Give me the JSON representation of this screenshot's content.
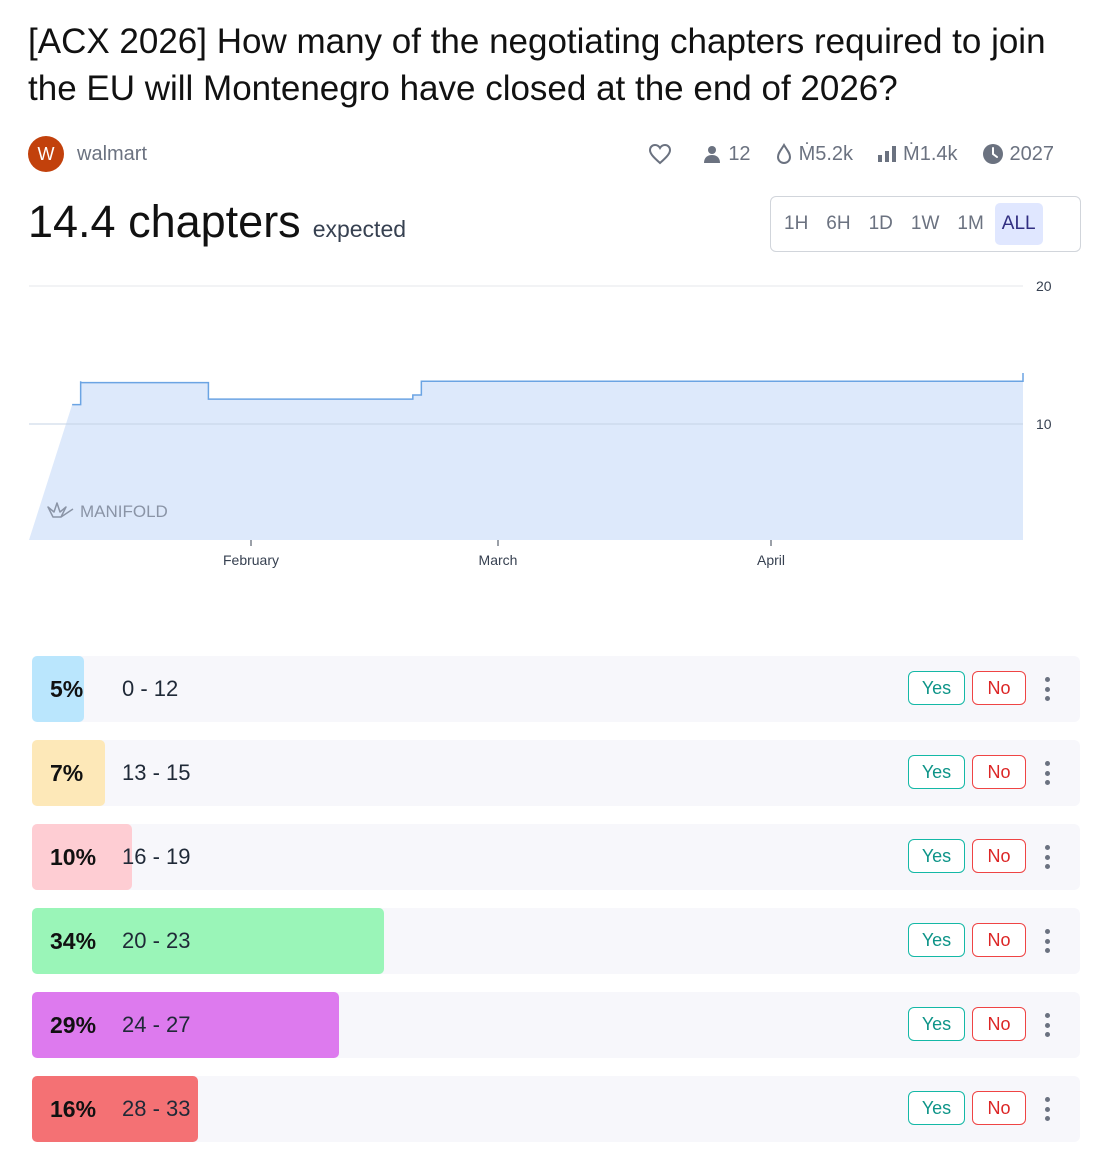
{
  "market": {
    "title": "[ACX 2026] How many of the negotiating chapters required to join the EU will Montenegro have closed at the end of 2026?",
    "author_initial": "W",
    "author": "walmart",
    "traders": "12",
    "volume": "Ṁ5.2k",
    "liquidity": "Ṁ1.4k",
    "close_year": "2027",
    "expected_value": "14.4 chapters",
    "expected_label": "expected"
  },
  "time_ranges": [
    "1H",
    "6H",
    "1D",
    "1W",
    "1M",
    "ALL"
  ],
  "selected_range": "ALL",
  "watermark": "MANIFOLD",
  "chart_data": {
    "type": "area",
    "x": [
      "Jan 11",
      "Jan 12",
      "Jan 12",
      "Jan 26",
      "Jan 27",
      "Feb 20",
      "Feb 21",
      "Apr 27",
      "May 3",
      "May 4",
      "May 10"
    ],
    "y": [
      11.4,
      13.1,
      13.0,
      13.0,
      11.8,
      12.1,
      13.1,
      13.1,
      13.2,
      13.5,
      13.7
    ],
    "x_ticks": [
      "February",
      "March",
      "April"
    ],
    "y_ticks": [
      10,
      20
    ],
    "ylim": [
      0,
      21
    ],
    "grid": "horizontal",
    "color": "#6ba4e3",
    "fill": "#dde9fb"
  },
  "answers": [
    {
      "pct": "5%",
      "value": 0.05,
      "label": "0 - 12",
      "color": "#bae6fd"
    },
    {
      "pct": "7%",
      "value": 0.07,
      "label": "13 - 15",
      "color": "#fde8b8"
    },
    {
      "pct": "10%",
      "value": 0.095,
      "label": "16 - 19",
      "color": "#fecdd3"
    },
    {
      "pct": "34%",
      "value": 0.336,
      "label": "20 - 23",
      "color": "#9af5b8"
    },
    {
      "pct": "29%",
      "value": 0.293,
      "label": "24 - 27",
      "color": "#dd7aee"
    },
    {
      "pct": "16%",
      "value": 0.158,
      "label": "28 - 33",
      "color": "#f47174"
    }
  ],
  "buttons": {
    "yes": "Yes",
    "no": "No"
  }
}
